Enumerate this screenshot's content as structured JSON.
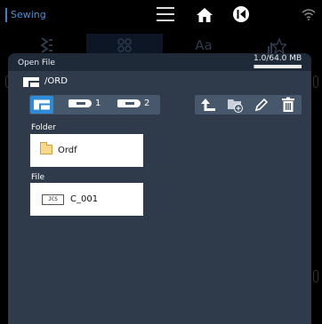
{
  "status_bar": {
    "mode_label": "Sewing"
  },
  "background_tabs": {
    "items": [
      "Aa"
    ]
  },
  "dialog": {
    "title": "Open File",
    "memory": {
      "text": "1.0/64.0 MB",
      "used_fraction": 0.016
    },
    "path": "/ORD",
    "sources": {
      "usb1_label": "1",
      "usb2_label": "2"
    },
    "folder_section": {
      "label": "Folder",
      "item_name": "Ordf"
    },
    "file_section": {
      "label": "File",
      "file_type_badge": "JCS",
      "item_name": "C_001"
    }
  },
  "colors": {
    "accent": "#2e8bd8",
    "dialog_bg": "#2f3b4b",
    "dialog_header": "#1f2a38",
    "button_group": "#47576c"
  },
  "icons": [
    "menu-icon",
    "home-icon",
    "back-circle-icon",
    "wifi-icon",
    "machine-icon",
    "usb-icon",
    "up-arrow-icon",
    "new-folder-icon",
    "pencil-icon",
    "trash-icon",
    "folder-icon",
    "file-type-icon"
  ]
}
